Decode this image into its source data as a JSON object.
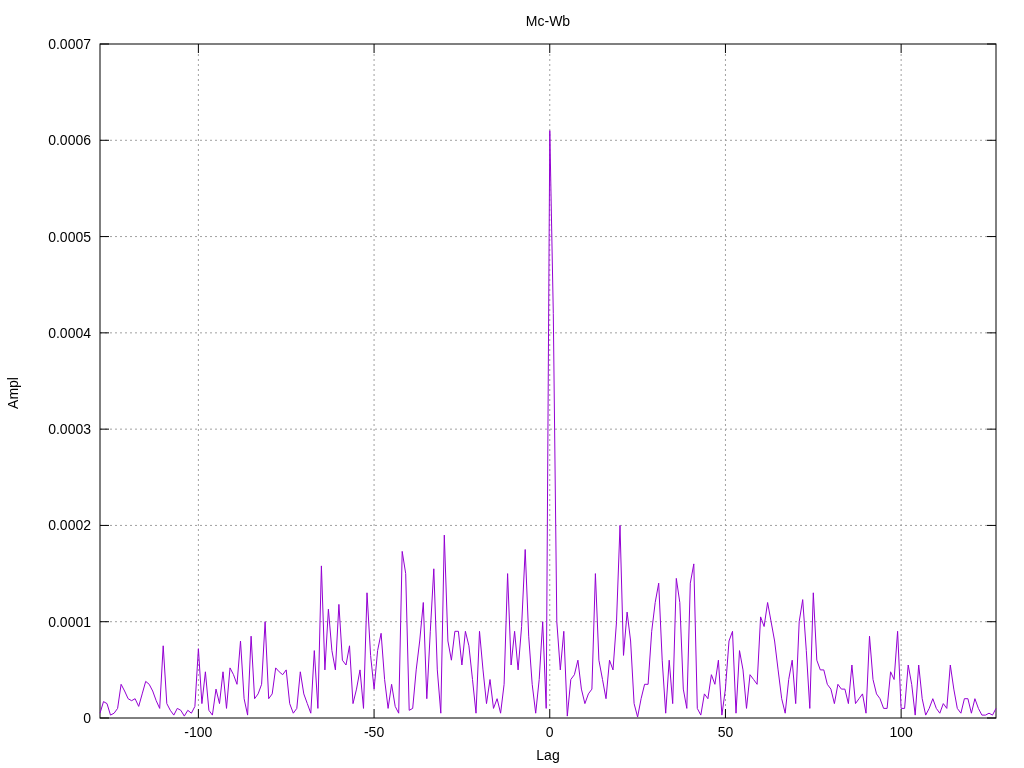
{
  "chart_data": {
    "type": "line",
    "grid": true,
    "title": "Mc-Wb",
    "xlabel": "Lag",
    "ylabel": "Ampl",
    "xlim": [
      -128,
      127
    ],
    "ylim": [
      0,
      0.0007
    ],
    "xticks": [
      -100,
      -50,
      0,
      50,
      100
    ],
    "yticks": [
      {
        "value": 0,
        "label": "0"
      },
      {
        "value": 0.0001,
        "label": "0.0001"
      },
      {
        "value": 0.0002,
        "label": "0.0002"
      },
      {
        "value": 0.0003,
        "label": "0.0003"
      },
      {
        "value": 0.0004,
        "label": "0.0004"
      },
      {
        "value": 0.0005,
        "label": "0.0005"
      },
      {
        "value": 0.0006,
        "label": "0.0006"
      },
      {
        "value": 0.0007,
        "label": "0.0007"
      }
    ],
    "x": [
      -128,
      -127,
      -126,
      -125,
      -124,
      -123,
      -122,
      -121,
      -120,
      -119,
      -118,
      -117,
      -116,
      -115,
      -114,
      -113,
      -112,
      -111,
      -110,
      -109,
      -108,
      -107,
      -106,
      -105,
      -104,
      -103,
      -102,
      -101,
      -100,
      -99,
      -98,
      -97,
      -96,
      -95,
      -94,
      -93,
      -92,
      -91,
      -90,
      -89,
      -88,
      -87,
      -86,
      -85,
      -84,
      -83,
      -82,
      -81,
      -80,
      -79,
      -78,
      -77,
      -76,
      -75,
      -74,
      -73,
      -72,
      -71,
      -70,
      -69,
      -68,
      -67,
      -66,
      -65,
      -64,
      -63,
      -62,
      -61,
      -60,
      -59,
      -58,
      -57,
      -56,
      -55,
      -54,
      -53,
      -52,
      -51,
      -50,
      -49,
      -48,
      -47,
      -46,
      -45,
      -44,
      -43,
      -42,
      -41,
      -40,
      -39,
      -38,
      -37,
      -36,
      -35,
      -34,
      -33,
      -32,
      -31,
      -30,
      -29,
      -28,
      -27,
      -26,
      -25,
      -24,
      -23,
      -22,
      -21,
      -20,
      -19,
      -18,
      -17,
      -16,
      -15,
      -14,
      -13,
      -12,
      -11,
      -10,
      -9,
      -8,
      -7,
      -6,
      -5,
      -4,
      -3,
      -2,
      -1,
      0,
      1,
      2,
      3,
      4,
      5,
      6,
      7,
      8,
      9,
      10,
      11,
      12,
      13,
      14,
      15,
      16,
      17,
      18,
      19,
      20,
      21,
      22,
      23,
      24,
      25,
      26,
      27,
      28,
      29,
      30,
      31,
      32,
      33,
      34,
      35,
      36,
      37,
      38,
      39,
      40,
      41,
      42,
      43,
      44,
      45,
      46,
      47,
      48,
      49,
      50,
      51,
      52,
      53,
      54,
      55,
      56,
      57,
      58,
      59,
      60,
      61,
      62,
      63,
      64,
      65,
      66,
      67,
      68,
      69,
      70,
      71,
      72,
      73,
      74,
      75,
      76,
      77,
      78,
      79,
      80,
      81,
      82,
      83,
      84,
      85,
      86,
      87,
      88,
      89,
      90,
      91,
      92,
      93,
      94,
      95,
      96,
      97,
      98,
      99,
      100,
      101,
      102,
      103,
      104,
      105,
      106,
      107,
      108,
      109,
      110,
      111,
      112,
      113,
      114,
      115,
      116,
      117,
      118,
      119,
      120,
      121,
      122,
      123,
      124,
      125,
      126,
      127
    ],
    "series": [
      {
        "color": "#9400d3",
        "values": [
          5e-06,
          1.7e-05,
          1.5e-05,
          3e-06,
          5e-06,
          1e-05,
          3.5e-05,
          2.8e-05,
          2e-05,
          1.8e-05,
          2e-05,
          1.2e-05,
          2.5e-05,
          3.8e-05,
          3.5e-05,
          2.8e-05,
          1.8e-05,
          1e-05,
          7.5e-05,
          1.5e-05,
          8e-06,
          3e-06,
          1e-05,
          8e-06,
          2e-06,
          8e-06,
          5e-06,
          1.2e-05,
          7.2e-05,
          1.5e-05,
          4.8e-05,
          8e-06,
          3e-06,
          3e-05,
          1.5e-05,
          4.8e-05,
          1e-05,
          5.2e-05,
          4.5e-05,
          3.5e-05,
          8e-05,
          2e-05,
          3e-06,
          8.5e-05,
          2e-05,
          2.5e-05,
          3.5e-05,
          0.0001,
          2e-05,
          2.5e-05,
          5.2e-05,
          4.8e-05,
          4.5e-05,
          5e-05,
          1.5e-05,
          5e-06,
          1e-05,
          4.8e-05,
          2.5e-05,
          1.5e-05,
          5e-06,
          7e-05,
          1e-05,
          0.000158,
          5e-05,
          0.000113,
          7e-05,
          5e-05,
          0.000118,
          6e-05,
          5.5e-05,
          7.5e-05,
          1.5e-05,
          3e-05,
          5e-05,
          1e-05,
          0.00013,
          6.5e-05,
          3e-05,
          7e-05,
          8.8e-05,
          4e-05,
          1e-05,
          3.5e-05,
          1.2e-05,
          5e-06,
          0.000173,
          0.00015,
          8e-06,
          1e-05,
          5e-05,
          8e-05,
          0.00012,
          2e-05,
          9e-05,
          0.000155,
          5e-05,
          5e-06,
          0.00019,
          8e-05,
          6e-05,
          9e-05,
          9e-05,
          5.5e-05,
          9e-05,
          7.5e-05,
          4e-05,
          5e-06,
          9e-05,
          5e-05,
          1.5e-05,
          4e-05,
          1e-05,
          2e-05,
          5e-06,
          3.5e-05,
          0.00015,
          5.5e-05,
          9e-05,
          5e-05,
          9.5e-05,
          0.000175,
          8.5e-05,
          3.5e-05,
          5e-06,
          4e-05,
          0.0001,
          1e-05,
          0.00061,
          0.00042,
          0.0001,
          5e-05,
          9e-05,
          2e-06,
          4e-05,
          4.5e-05,
          6e-05,
          3e-05,
          1.5e-05,
          2.5e-05,
          3e-05,
          0.00015,
          6e-05,
          4e-05,
          2e-05,
          6e-05,
          5e-05,
          0.0001,
          0.0002,
          6.5e-05,
          0.00011,
          8e-05,
          1.5e-05,
          1e-06,
          2e-05,
          3.5e-05,
          3.5e-05,
          9e-05,
          0.00012,
          0.00014,
          6e-05,
          5e-06,
          6e-05,
          1.5e-05,
          0.000145,
          0.00012,
          3e-05,
          1e-05,
          0.00014,
          0.00016,
          1e-05,
          3e-06,
          2.5e-05,
          2e-05,
          4.5e-05,
          3.5e-05,
          6e-05,
          3e-06,
          3e-05,
          8e-05,
          9e-05,
          5e-06,
          7e-05,
          5e-05,
          1e-05,
          4.5e-05,
          4e-05,
          3.5e-05,
          0.000105,
          9.5e-05,
          0.00012,
          0.0001,
          8e-05,
          5e-05,
          2e-05,
          5e-06,
          4e-05,
          6e-05,
          1.5e-05,
          0.0001,
          0.000123,
          7e-05,
          1e-05,
          0.00013,
          6e-05,
          5e-05,
          5e-05,
          3.5e-05,
          3e-05,
          1.5e-05,
          3.5e-05,
          3e-05,
          3e-05,
          1.5e-05,
          5.5e-05,
          1.5e-05,
          2e-05,
          2.5e-05,
          5e-06,
          8.5e-05,
          4e-05,
          2.5e-05,
          2e-05,
          1e-05,
          1e-05,
          4.8e-05,
          4e-05,
          9e-05,
          1e-05,
          1e-05,
          5.5e-05,
          3.5e-05,
          3e-06,
          5.5e-05,
          2e-05,
          3e-06,
          1e-05,
          2e-05,
          1e-05,
          5e-06,
          1.5e-05,
          1e-05,
          5.5e-05,
          3e-05,
          1e-05,
          5e-06,
          2e-05,
          2e-05,
          5e-06,
          2e-05,
          1e-05,
          3e-06,
          3e-06,
          5e-06,
          3e-06,
          1e-05
        ]
      }
    ]
  }
}
